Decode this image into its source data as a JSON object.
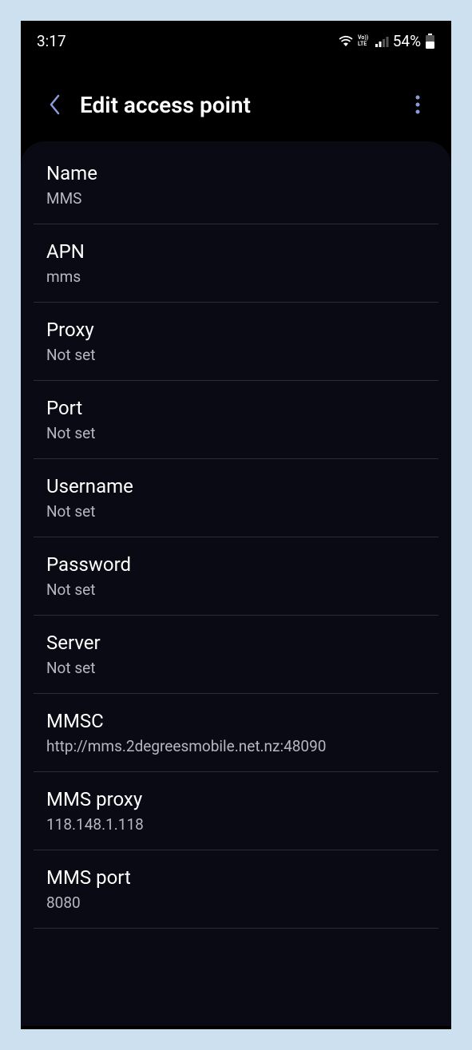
{
  "statusBar": {
    "time": "3:17",
    "battery": "54%"
  },
  "header": {
    "title": "Edit access point"
  },
  "settings": [
    {
      "label": "Name",
      "value": "MMS"
    },
    {
      "label": "APN",
      "value": "mms"
    },
    {
      "label": "Proxy",
      "value": "Not set"
    },
    {
      "label": "Port",
      "value": "Not set"
    },
    {
      "label": "Username",
      "value": "Not set"
    },
    {
      "label": "Password",
      "value": "Not set"
    },
    {
      "label": "Server",
      "value": "Not set"
    },
    {
      "label": "MMSC",
      "value": "http://mms.2degreesmobile.net.nz:48090"
    },
    {
      "label": "MMS proxy",
      "value": "118.148.1.118"
    },
    {
      "label": "MMS port",
      "value": "8080"
    }
  ]
}
